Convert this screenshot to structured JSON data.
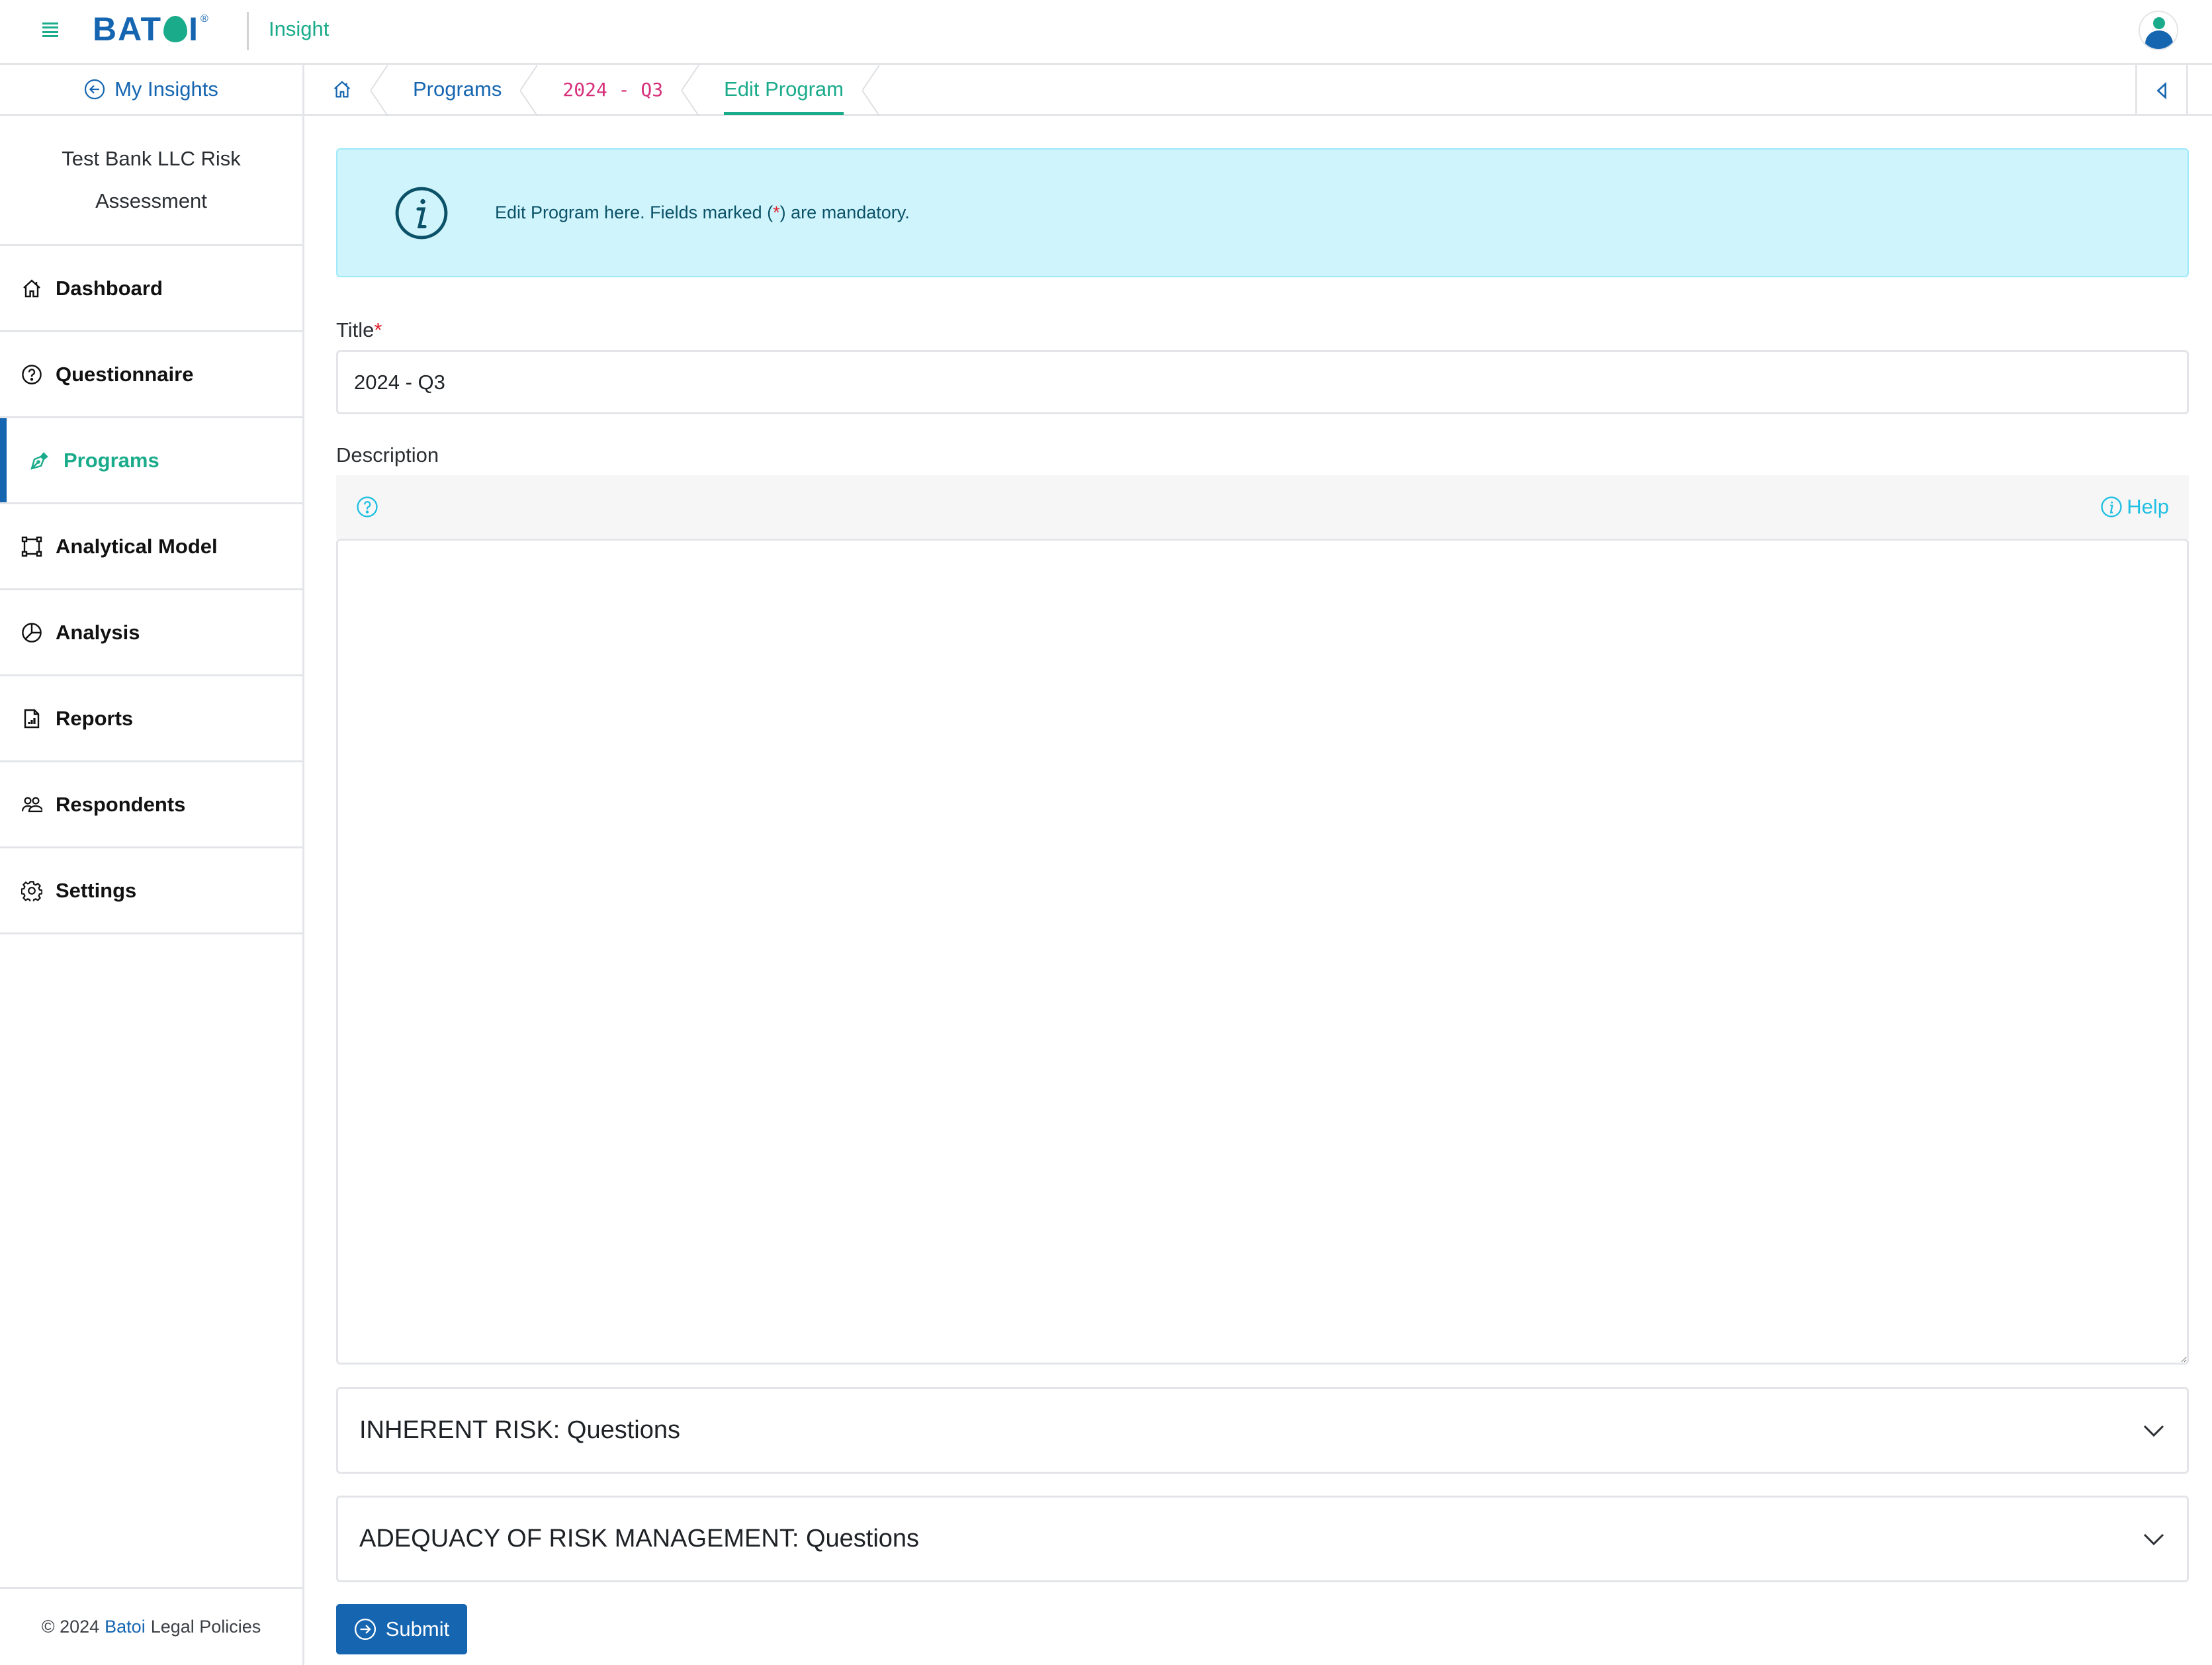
{
  "header": {
    "menu_icon": "hamburger-icon",
    "logo_text": "BATOI",
    "logo_registered": "®",
    "app_name": "Insight",
    "avatar_icon": "user-avatar-icon"
  },
  "sidebar": {
    "back_link": {
      "label": "My Insights",
      "icon": "arrow-left-circle-icon"
    },
    "project_title": "Test Bank LLC Risk Assessment",
    "items": [
      {
        "label": "Dashboard",
        "icon": "home-icon",
        "active": false
      },
      {
        "label": "Questionnaire",
        "icon": "question-circle-icon",
        "active": false
      },
      {
        "label": "Programs",
        "icon": "pen-nib-icon",
        "active": true
      },
      {
        "label": "Analytical Model",
        "icon": "bounding-box-icon",
        "active": false
      },
      {
        "label": "Analysis",
        "icon": "pie-chart-icon",
        "active": false
      },
      {
        "label": "Reports",
        "icon": "file-bar-chart-icon",
        "active": false
      },
      {
        "label": "Respondents",
        "icon": "people-icon",
        "active": false
      },
      {
        "label": "Settings",
        "icon": "gear-icon",
        "active": false
      }
    ],
    "footer": {
      "copyright": "© 2024",
      "brand": "Batoi",
      "legal": "Legal Policies"
    }
  },
  "breadcrumb": {
    "home_icon": "home-icon",
    "items": [
      "Programs",
      "2024 - Q3",
      "Edit Program"
    ],
    "collapse_icon": "caret-left-icon"
  },
  "colors": {
    "brand_blue": "#1565b0",
    "brand_green": "#1aab8b",
    "breadcrumb_program": "#d6307a",
    "alert_bg": "#cff4fc",
    "help_cyan": "#1fbfe3",
    "required_red": "#e0202d"
  },
  "alert": {
    "icon": "info-circle-icon",
    "text_before": "Edit Program here. Fields marked (",
    "asterisk": "*",
    "text_after": ") are mandatory."
  },
  "form": {
    "title_label": "Title",
    "required_marker": "*",
    "title_value": "2024 - Q3",
    "description_label": "Description",
    "description_value": "",
    "editor_help_label": "Help"
  },
  "accordions": [
    {
      "label": "INHERENT RISK: Questions"
    },
    {
      "label": "ADEQUACY OF RISK MANAGEMENT: Questions"
    }
  ],
  "submit_label": "Submit"
}
